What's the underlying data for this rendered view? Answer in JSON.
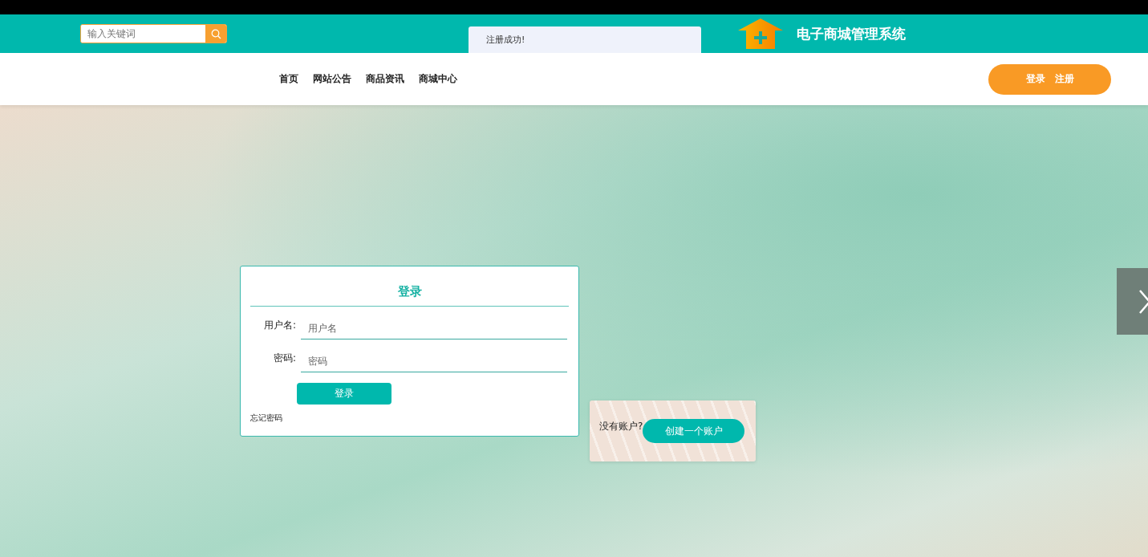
{
  "header": {
    "search": {
      "placeholder": "输入关键词"
    },
    "title": "电子商城管理系统"
  },
  "toast": {
    "message": "注册成功!"
  },
  "nav": {
    "items": [
      "首页",
      "网站公告",
      "商品资讯",
      "商城中心"
    ],
    "auth_links": [
      "登录",
      "注册"
    ]
  },
  "login_form": {
    "title": "登录",
    "fields": [
      {
        "label": "用户名:",
        "placeholder": "用户名"
      },
      {
        "label": "密码:",
        "placeholder": "密码"
      }
    ],
    "submit": "登录",
    "forgot": "忘记密码"
  },
  "signup_card": {
    "prompt": "没有账户?",
    "button": "创建一个账户"
  }
}
